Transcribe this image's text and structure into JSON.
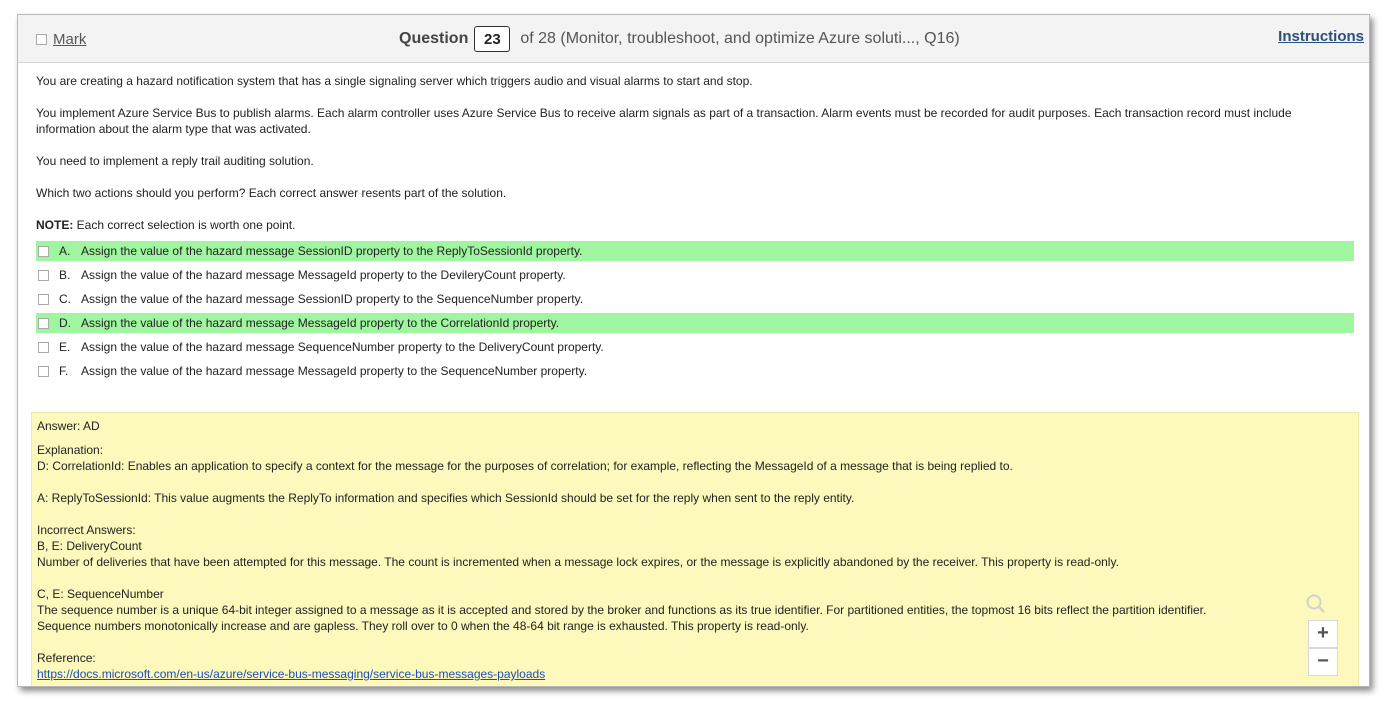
{
  "header": {
    "mark_label": "Mark",
    "question_word": "Question",
    "question_number": "23",
    "question_context": "of 28 (Monitor, troubleshoot, and optimize Azure soluti..., Q16)",
    "instructions_label": "Instructions"
  },
  "question": {
    "paragraphs": [
      "You are creating a hazard notification system that has a single signaling server which triggers audio and visual alarms to start and stop.",
      "You implement Azure Service Bus to publish alarms. Each alarm controller uses Azure Service Bus to receive alarm signals as part of a transaction. Alarm events must be recorded for audit purposes. Each transaction record must include information about the alarm type that was activated.",
      "You need to implement a reply trail auditing solution.",
      "Which two actions should you perform? Each correct answer resents part of the solution."
    ],
    "note_label": "NOTE:",
    "note_text": " Each correct selection is worth one point."
  },
  "options": [
    {
      "letter": "A.",
      "text": "Assign the value of the hazard message SessionID property to the ReplyToSessionId property."
    },
    {
      "letter": "B.",
      "text": "Assign the value of the hazard message MessageId property to the DevileryCount property."
    },
    {
      "letter": "C.",
      "text": "Assign the value of the hazard message SessionID property to the SequenceNumber property."
    },
    {
      "letter": "D.",
      "text": "Assign the value of the hazard message MessageId property to the CorrelationId property."
    },
    {
      "letter": "E.",
      "text": "Assign the value of the hazard message SequenceNumber property to the DeliveryCount property."
    },
    {
      "letter": "F.",
      "text": "Assign the value of the hazard message MessageId property to the SequenceNumber property."
    }
  ],
  "answer": {
    "answer_line": "Answer: AD",
    "explanation_label": "Explanation:",
    "explanation_d": "D: CorrelationId: Enables an application to specify a context for the message for the purposes of correlation; for example, reflecting the MessageId of a message that is being replied to.",
    "explanation_a": "A: ReplyToSessionId: This value augments the ReplyTo information and specifies which SessionId should be set for the reply when sent to the reply entity.",
    "incorrect_label": "Incorrect Answers:",
    "be_heading": "B, E: DeliveryCount",
    "be_text": "Number of deliveries that have been attempted for this message. The count is incremented when a message lock expires, or the message is explicitly abandoned by the receiver. This property is read-only.",
    "ce_heading": "C, E: SequenceNumber",
    "ce_text_1": "The sequence number is a unique 64-bit integer assigned to a message as it is accepted and stored by the broker and functions as its true identifier. For partitioned entities, the topmost 16 bits reflect the partition identifier.",
    "ce_text_2": "Sequence numbers monotonically increase and are gapless. They roll over to 0 when the 48-64 bit range is exhausted. This property is read-only.",
    "reference_label": "Reference:",
    "reference_url": "https://docs.microsoft.com/en-us/azure/service-bus-messaging/service-bus-messages-payloads"
  },
  "colors": {
    "correct_highlight": "#a0f5a0",
    "answer_background": "#fdf8bb",
    "link": "#1a4fb5"
  },
  "icons": {
    "search": "magnifier-icon",
    "zoom_in": "plus-icon",
    "zoom_out": "minus-icon"
  },
  "zoom": {
    "in_symbol": "+",
    "out_symbol": "−"
  }
}
